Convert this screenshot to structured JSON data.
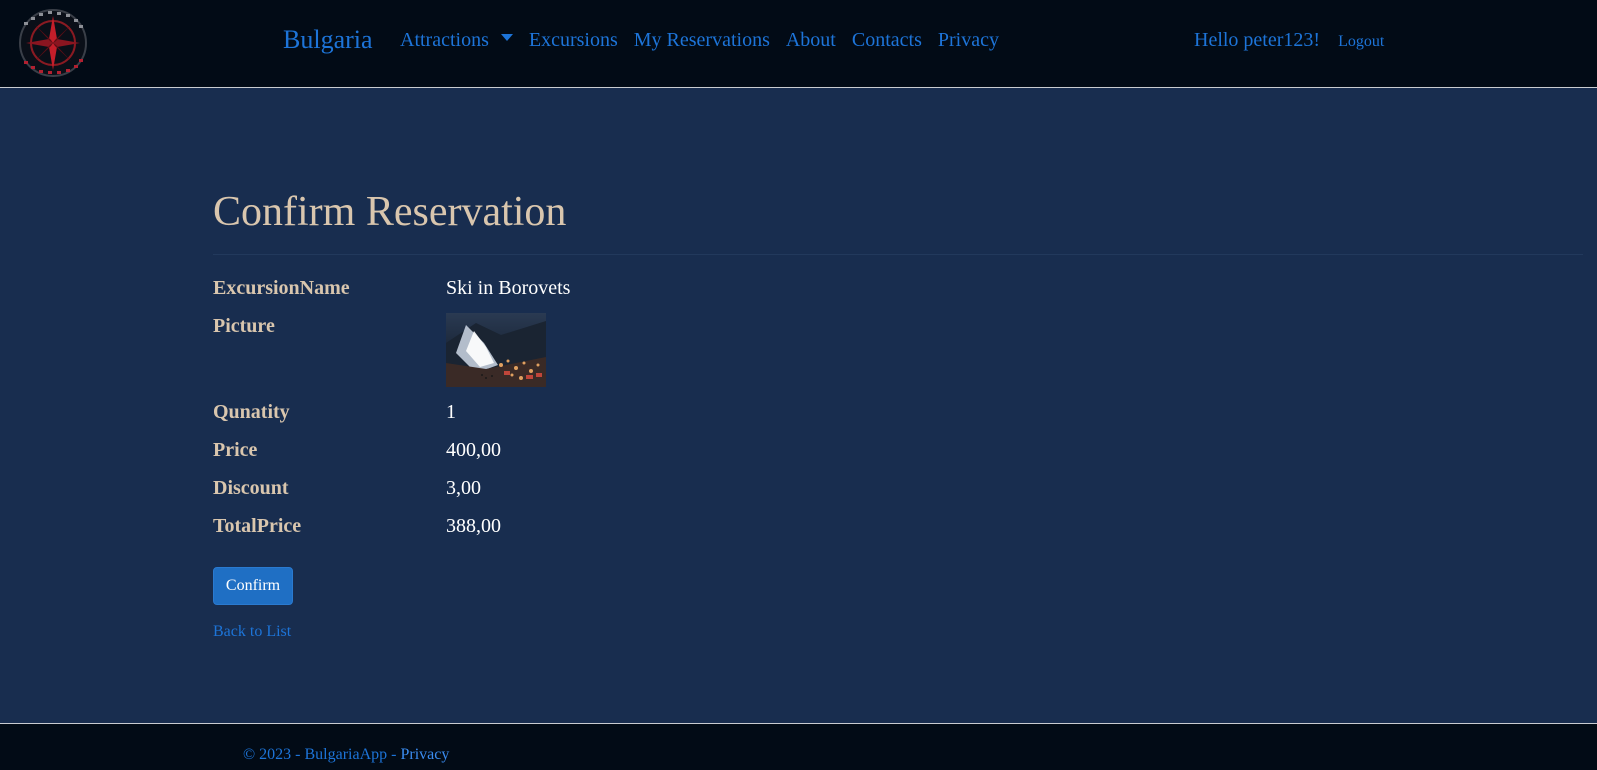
{
  "nav": {
    "brand": "Bulgaria",
    "links": [
      "Attractions",
      "Excursions",
      "My Reservations",
      "About",
      "Contacts",
      "Privacy"
    ],
    "greeting": "Hello peter123!",
    "logout": "Logout"
  },
  "page": {
    "title": "Confirm Reservation"
  },
  "details": {
    "excursion_name_label": "ExcursionName",
    "excursion_name_value": "Ski in Borovets",
    "picture_label": "Picture",
    "quantity_label": "Qunatity",
    "quantity_value": "1",
    "price_label": "Price",
    "price_value": "400,00",
    "discount_label": "Discount",
    "discount_value": "3,00",
    "total_label": "TotalPrice",
    "total_value": "388,00"
  },
  "actions": {
    "confirm_label": "Confirm",
    "back_label": "Back to List"
  },
  "footer": {
    "copyright": "© 2023 - BulgariaApp - ",
    "privacy": "Privacy"
  },
  "colors": {
    "navbar_bg": "#020b16",
    "page_bg": "#182d4f",
    "link": "#1d74d8",
    "label": "#d9c6ae",
    "button": "#1f6fc4"
  },
  "icons": {
    "logo": "compass-logo",
    "dropdown": "caret-down-icon"
  }
}
